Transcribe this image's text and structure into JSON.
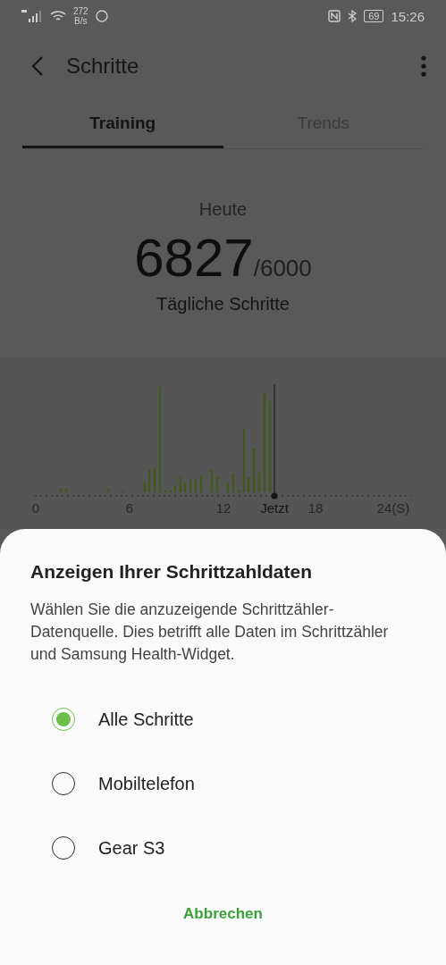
{
  "status_bar": {
    "net_speed": "272",
    "net_unit": "B/s",
    "battery": "69",
    "time": "15:26"
  },
  "header": {
    "title": "Schritte"
  },
  "tabs": [
    {
      "label": "Training",
      "selected": true
    },
    {
      "label": "Trends",
      "selected": false
    }
  ],
  "summary": {
    "day": "Heute",
    "steps": "6827",
    "goal": "/6000",
    "caption": "Tägliche Schritte"
  },
  "timeline": {
    "axis_labels": [
      "0",
      "6",
      "12",
      "18",
      "24(S)"
    ],
    "now_label": "Jetzt"
  },
  "sheet": {
    "title": "Anzeigen Ihrer Schrittzahldaten",
    "description": "Wählen Sie die anzuzeigende Schrittzähler-Datenquelle. Dies betrifft alle Daten im Schrittzähler und Samsung Health-Widget.",
    "options": [
      {
        "label": "Alle Schritte",
        "selected": true
      },
      {
        "label": "Mobiltelefon",
        "selected": false
      },
      {
        "label": "Gear S3",
        "selected": false
      }
    ],
    "cancel": "Abbrechen"
  }
}
